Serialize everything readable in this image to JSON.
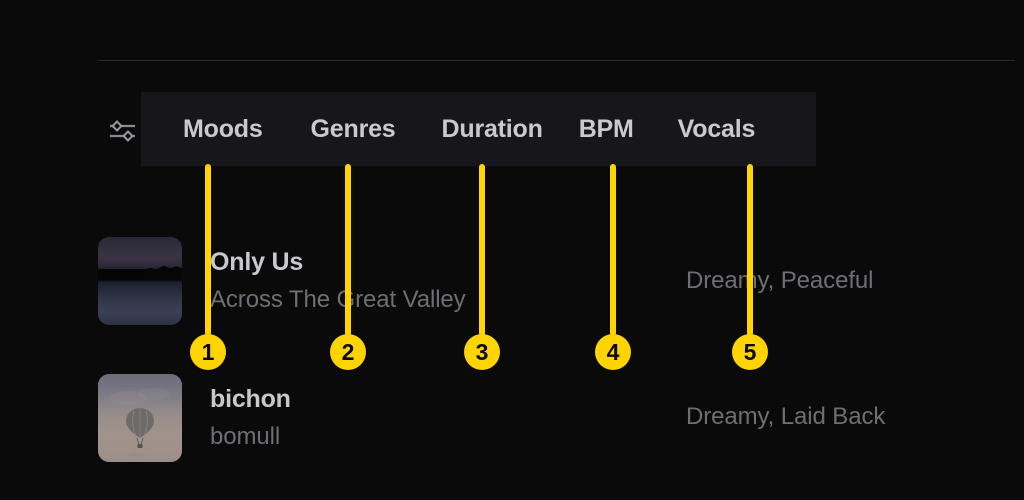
{
  "app": {
    "background_color": "#0a0a0a",
    "panel_color": "#17171b",
    "accent_color": "#FFD400"
  },
  "filter_bar": {
    "icon_name": "sliders-icon",
    "items": [
      {
        "label": "Moods"
      },
      {
        "label": "Genres"
      },
      {
        "label": "Duration"
      },
      {
        "label": "BPM"
      },
      {
        "label": "Vocals"
      }
    ]
  },
  "tracks": [
    {
      "title": "Only Us",
      "artist": "Across The Great Valley",
      "tags": "Dreamy, Peaceful",
      "artwork_name": "lake-dusk-artwork"
    },
    {
      "title": "bichon",
      "artist": "bomull",
      "tags": "Dreamy, Laid Back",
      "artwork_name": "hot-air-balloon-artwork"
    }
  ],
  "annotations": {
    "color": "#FFD400",
    "markers": [
      {
        "number": "1",
        "target": "Moods"
      },
      {
        "number": "2",
        "target": "Genres"
      },
      {
        "number": "3",
        "target": "Duration"
      },
      {
        "number": "4",
        "target": "BPM"
      },
      {
        "number": "5",
        "target": "Vocals"
      }
    ]
  }
}
